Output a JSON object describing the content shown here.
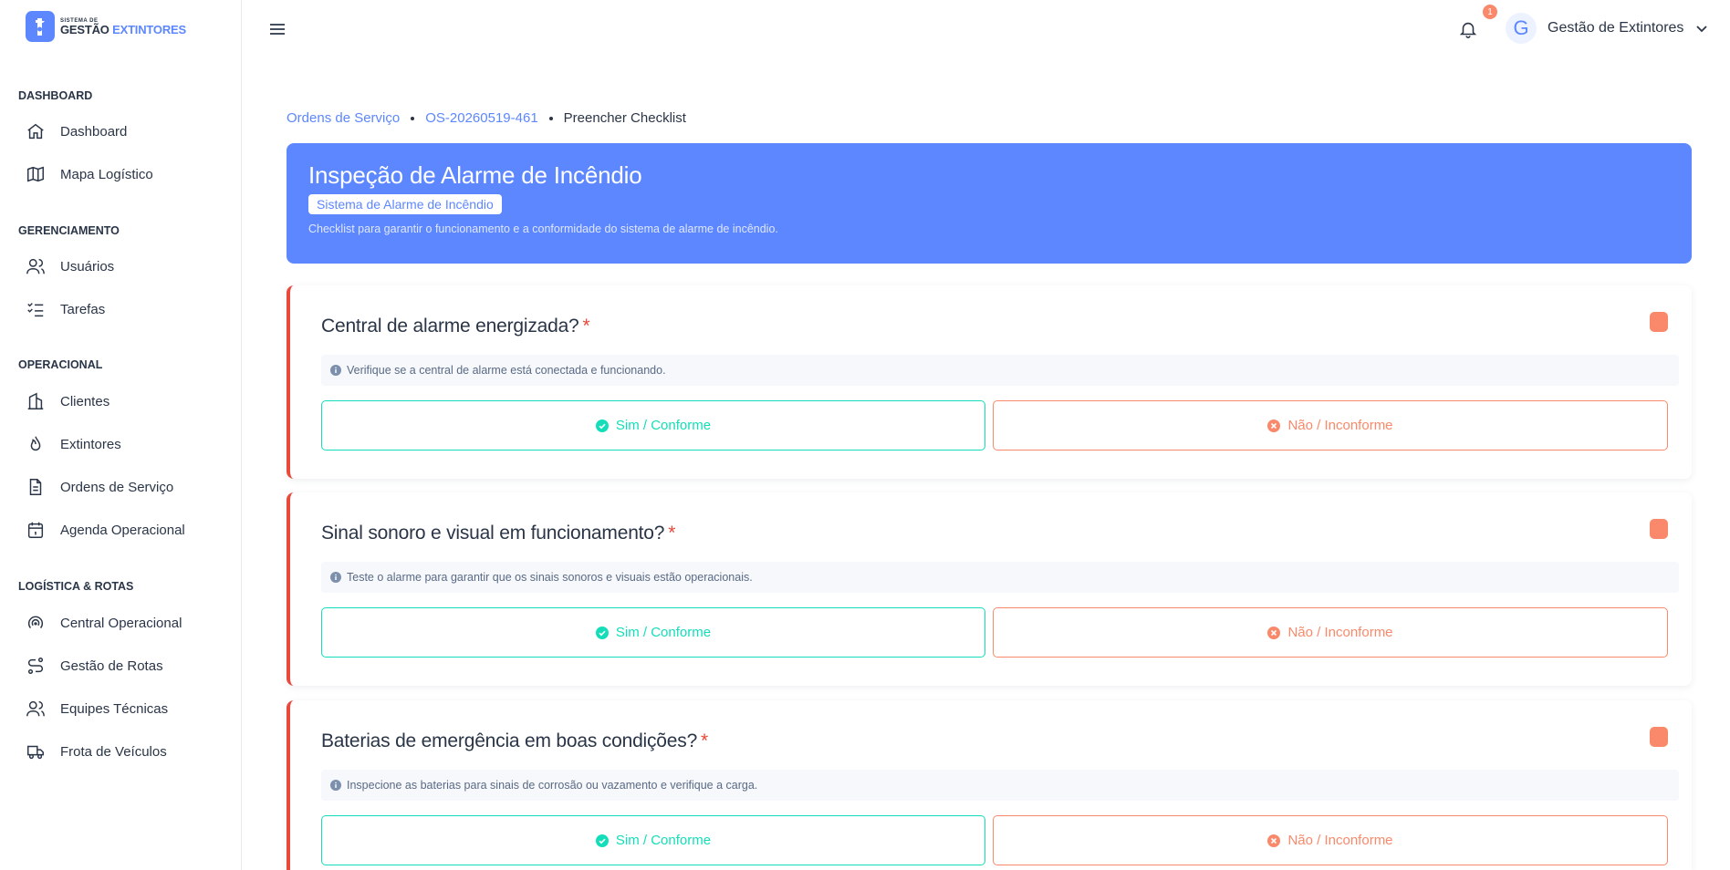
{
  "app": {
    "logo_small": "SISTEMA DE",
    "logo_main_1": "GESTÃO",
    "logo_main_2": "EXTINTORES"
  },
  "sidebar": {
    "sections": [
      {
        "title": "DASHBOARD",
        "items": [
          {
            "label": "Dashboard",
            "icon": "home-icon"
          },
          {
            "label": "Mapa Logístico",
            "icon": "map-icon"
          }
        ]
      },
      {
        "title": "GERENCIAMENTO",
        "items": [
          {
            "label": "Usuários",
            "icon": "users-icon"
          },
          {
            "label": "Tarefas",
            "icon": "list-check-icon"
          }
        ]
      },
      {
        "title": "OPERACIONAL",
        "items": [
          {
            "label": "Clientes",
            "icon": "building-icon"
          },
          {
            "label": "Extintores",
            "icon": "flame-icon"
          },
          {
            "label": "Ordens de Serviço",
            "icon": "file-text-icon"
          },
          {
            "label": "Agenda Operacional",
            "icon": "calendar-icon"
          }
        ]
      },
      {
        "title": "LOGÍSTICA & ROTAS",
        "items": [
          {
            "label": "Central Operacional",
            "icon": "broadcast-icon"
          },
          {
            "label": "Gestão de Rotas",
            "icon": "route-icon"
          },
          {
            "label": "Equipes Técnicas",
            "icon": "team-icon"
          },
          {
            "label": "Frota de Veículos",
            "icon": "truck-icon"
          }
        ]
      }
    ]
  },
  "header": {
    "notification_count": "1",
    "avatar_letter": "G",
    "user_name": "Gestão de Extintores"
  },
  "breadcrumb": {
    "items": [
      "Ordens de Serviço",
      "OS-20260519-461"
    ],
    "current": "Preencher Checklist"
  },
  "banner": {
    "title": "Inspeção de Alarme de Incêndio",
    "tag": "Sistema de Alarme de Incêndio",
    "description": "Checklist para garantir o funcionamento e a conformidade do sistema de alarme de incêndio."
  },
  "questions": [
    {
      "title": "Central de alarme energizada?",
      "required": "*",
      "hint": "Verifique se a central de alarme está conectada e funcionando.",
      "yes_label": "Sim / Conforme",
      "no_label": "Não / Inconforme"
    },
    {
      "title": "Sinal sonoro e visual em funcionamento?",
      "required": "*",
      "hint": "Teste o alarme para garantir que os sinais sonoros e visuais estão operacionais.",
      "yes_label": "Sim / Conforme",
      "no_label": "Não / Inconforme"
    },
    {
      "title": "Baterias de emergência em boas condições?",
      "required": "*",
      "hint": "Inspecione as baterias para sinais de corrosão ou vazamento e verifique a carga.",
      "yes_label": "Sim / Conforme",
      "no_label": "Não / Inconforme"
    }
  ],
  "colors": {
    "primary": "#5d87ff",
    "success": "#13deb9",
    "warning": "#fa896b",
    "danger": "#e8493a"
  }
}
